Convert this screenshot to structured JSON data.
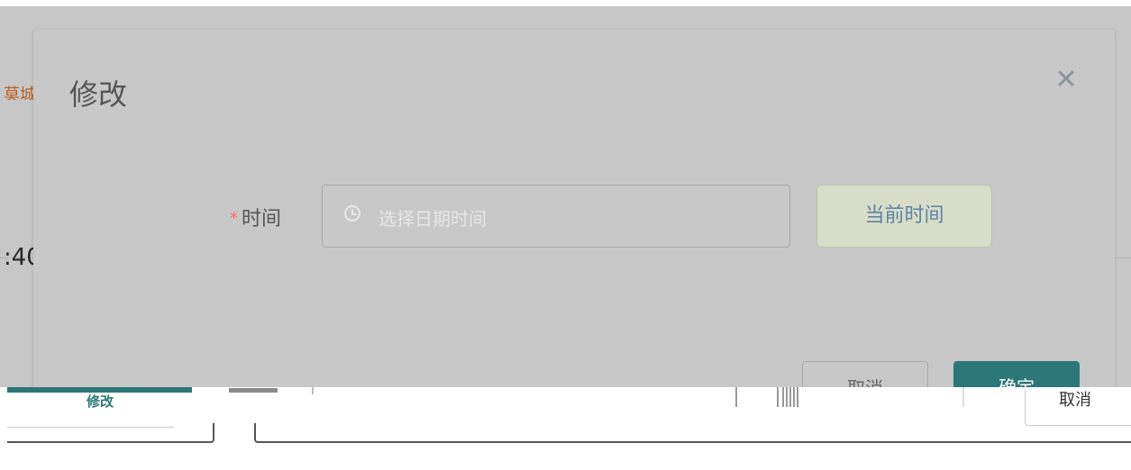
{
  "background": {
    "link_text": "莫城",
    "number_text": ":40"
  },
  "dialog": {
    "title": "修改",
    "close_icon": "close-icon",
    "form": {
      "required_mark": "*",
      "time_label": "时间",
      "datetime_placeholder": "选择日期时间",
      "clock_icon": "clock-icon",
      "now_button_label": "当前时间"
    },
    "footer": {
      "cancel_label": "取消",
      "ok_label": "确定"
    }
  },
  "bottom": {
    "edit_tab_label": "修改",
    "right_text": "取消"
  },
  "colors": {
    "primary": "#2c7777",
    "required": "#f56c6c",
    "link_orange": "#f07a2a",
    "now_button_bg": "#d8ddc8"
  }
}
